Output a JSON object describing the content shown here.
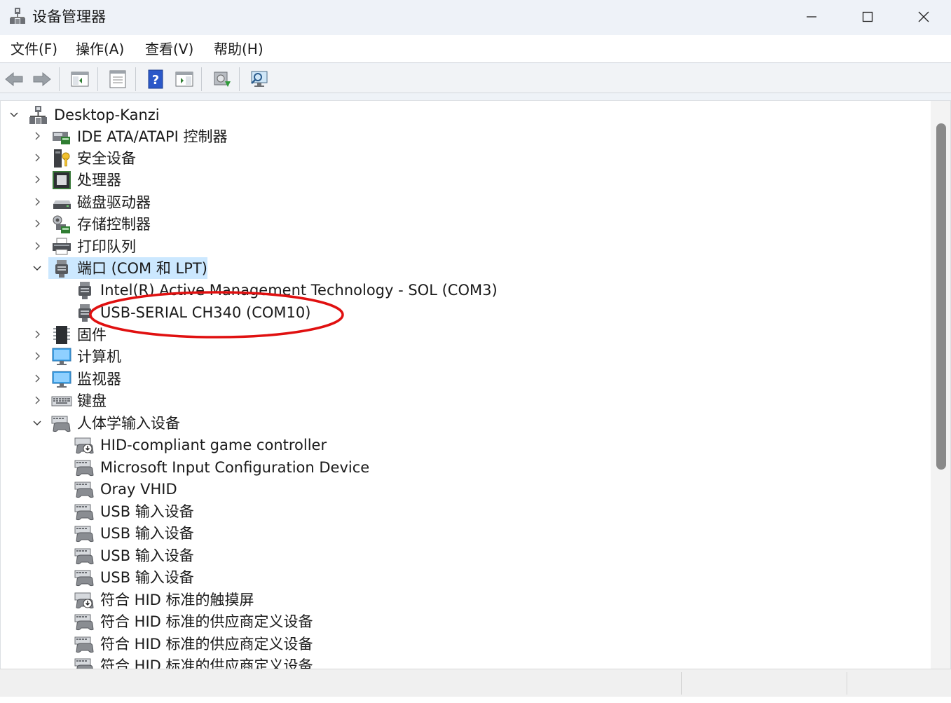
{
  "window": {
    "title": "设备管理器",
    "minimize_icon": "minimize-icon",
    "maximize_icon": "maximize-icon",
    "close_icon": "close-icon"
  },
  "menu": [
    "文件(F)",
    "操作(A)",
    "查看(V)",
    "帮助(H)"
  ],
  "toolbar": [
    "back-arrow-icon",
    "forward-arrow-icon",
    "show-hide-console-tree-icon",
    "properties-icon",
    "help-icon",
    "action-pane-icon",
    "update-driver-icon",
    "scan-hardware-icon"
  ],
  "tree": {
    "root": "Desktop-Kanzi",
    "items": [
      {
        "label": "IDE ATA/ATAPI 控制器",
        "icon": "ide-controller-icon",
        "expanded": false,
        "level": 1
      },
      {
        "label": "安全设备",
        "icon": "security-device-icon",
        "expanded": false,
        "level": 1
      },
      {
        "label": "处理器",
        "icon": "processor-icon",
        "expanded": false,
        "level": 1
      },
      {
        "label": "磁盘驱动器",
        "icon": "disk-drive-icon",
        "expanded": false,
        "level": 1
      },
      {
        "label": "存储控制器",
        "icon": "storage-controller-icon",
        "expanded": false,
        "level": 1
      },
      {
        "label": "打印队列",
        "icon": "printer-icon",
        "expanded": false,
        "level": 1
      },
      {
        "label": "端口 (COM 和 LPT)",
        "icon": "port-icon",
        "expanded": true,
        "level": 1,
        "selected": true
      },
      {
        "label": "Intel(R) Active Management Technology - SOL (COM3)",
        "icon": "port-icon",
        "level": 2
      },
      {
        "label": "USB-SERIAL CH340 (COM10)",
        "icon": "port-icon",
        "level": 2
      },
      {
        "label": "固件",
        "icon": "firmware-icon",
        "expanded": false,
        "level": 1
      },
      {
        "label": "计算机",
        "icon": "computer-icon",
        "expanded": false,
        "level": 1
      },
      {
        "label": "监视器",
        "icon": "monitor-icon",
        "expanded": false,
        "level": 1
      },
      {
        "label": "键盘",
        "icon": "keyboard-icon",
        "expanded": false,
        "level": 1
      },
      {
        "label": "人体学输入设备",
        "icon": "hid-icon",
        "expanded": true,
        "level": 1
      },
      {
        "label": "HID-compliant game controller",
        "icon": "hid-warning-icon",
        "level": 2
      },
      {
        "label": "Microsoft Input Configuration Device",
        "icon": "hid-icon",
        "level": 2
      },
      {
        "label": "Oray VHID",
        "icon": "hid-icon",
        "level": 2
      },
      {
        "label": "USB 输入设备",
        "icon": "hid-icon",
        "level": 2
      },
      {
        "label": "USB 输入设备",
        "icon": "hid-icon",
        "level": 2
      },
      {
        "label": "USB 输入设备",
        "icon": "hid-icon",
        "level": 2
      },
      {
        "label": "USB 输入设备",
        "icon": "hid-icon",
        "level": 2
      },
      {
        "label": "符合 HID 标准的触摸屏",
        "icon": "hid-warning-icon",
        "level": 2
      },
      {
        "label": "符合 HID 标准的供应商定义设备",
        "icon": "hid-icon",
        "level": 2
      },
      {
        "label": "符合 HID 标准的供应商定义设备",
        "icon": "hid-icon",
        "level": 2
      },
      {
        "label": "符合 HID 标准的供应商定义设备",
        "icon": "hid-icon",
        "level": 2
      }
    ]
  },
  "colors": {
    "selection": "#cce8ff",
    "annotation": "#e01010",
    "titlebar": "#eef2f8"
  }
}
